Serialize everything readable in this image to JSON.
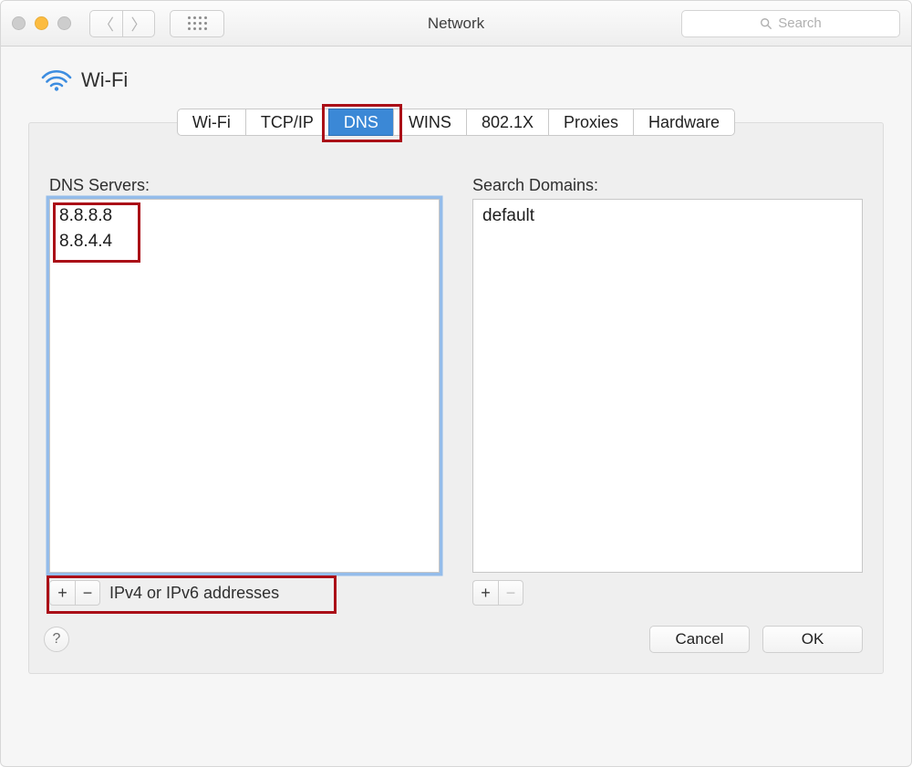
{
  "window": {
    "title": "Network"
  },
  "search": {
    "placeholder": "Search"
  },
  "section": {
    "name": "Wi-Fi"
  },
  "tabs": [
    {
      "label": "Wi-Fi",
      "active": false
    },
    {
      "label": "TCP/IP",
      "active": false
    },
    {
      "label": "DNS",
      "active": true
    },
    {
      "label": "WINS",
      "active": false
    },
    {
      "label": "802.1X",
      "active": false
    },
    {
      "label": "Proxies",
      "active": false
    },
    {
      "label": "Hardware",
      "active": false
    }
  ],
  "dns": {
    "servers_label": "DNS Servers:",
    "servers": [
      "8.8.8.8",
      "8.8.4.4"
    ],
    "hint": "IPv4 or IPv6 addresses",
    "domains_label": "Search Domains:",
    "domains": [
      "default"
    ]
  },
  "buttons": {
    "cancel": "Cancel",
    "ok": "OK",
    "help": "?"
  },
  "glyphs": {
    "plus": "+",
    "minus": "−",
    "back": "〈",
    "forward": "〉"
  }
}
